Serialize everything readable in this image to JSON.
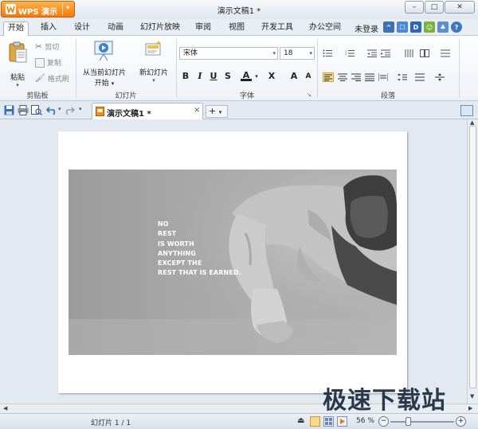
{
  "app": {
    "brand_label": "WPS 演示",
    "window_title": "演示文稿1 *",
    "window_controls": [
      "–",
      "□",
      "✕"
    ]
  },
  "menu": {
    "tabs": [
      "开始",
      "插入",
      "设计",
      "动画",
      "幻灯片放映",
      "审阅",
      "视图",
      "开发工具",
      "办公空间"
    ],
    "active_tab": "开始",
    "login": "未登录"
  },
  "ribbon": {
    "clipboard": {
      "paste": "粘贴",
      "cut": "剪切",
      "copy": "复制",
      "format_painter": "格式刷",
      "group_label": "剪贴板"
    },
    "slides": {
      "from_current_line1": "从当前幻灯片",
      "from_current_line2": "开始",
      "new_slide": "新幻灯片",
      "group_label": "幻灯片"
    },
    "font": {
      "font_name": "宋体",
      "font_size": "18",
      "bold": "B",
      "italic": "I",
      "underline": "U",
      "strikethrough": "S",
      "font_color": "A",
      "superscript": "X",
      "grow": "A",
      "shrink": "A",
      "group_label": "字体"
    },
    "paragraph": {
      "group_label": "段落"
    }
  },
  "document": {
    "tab_name": "演示文稿1 *",
    "new_tab": "+",
    "slide_quote": [
      "NO",
      "REST",
      "IS WORTH",
      "ANYTHING",
      "EXCEPT THE",
      "REST THAT IS EARNED."
    ]
  },
  "status": {
    "page": "幻灯片 1 / 1",
    "zoom": "56 %",
    "zoom_value": 56
  },
  "watermark": "极速下载站",
  "colors": {
    "brand_orange": "#f07a10",
    "ribbon_bg": "#eef2f7",
    "workspace_bg": "#e3e9f1"
  }
}
